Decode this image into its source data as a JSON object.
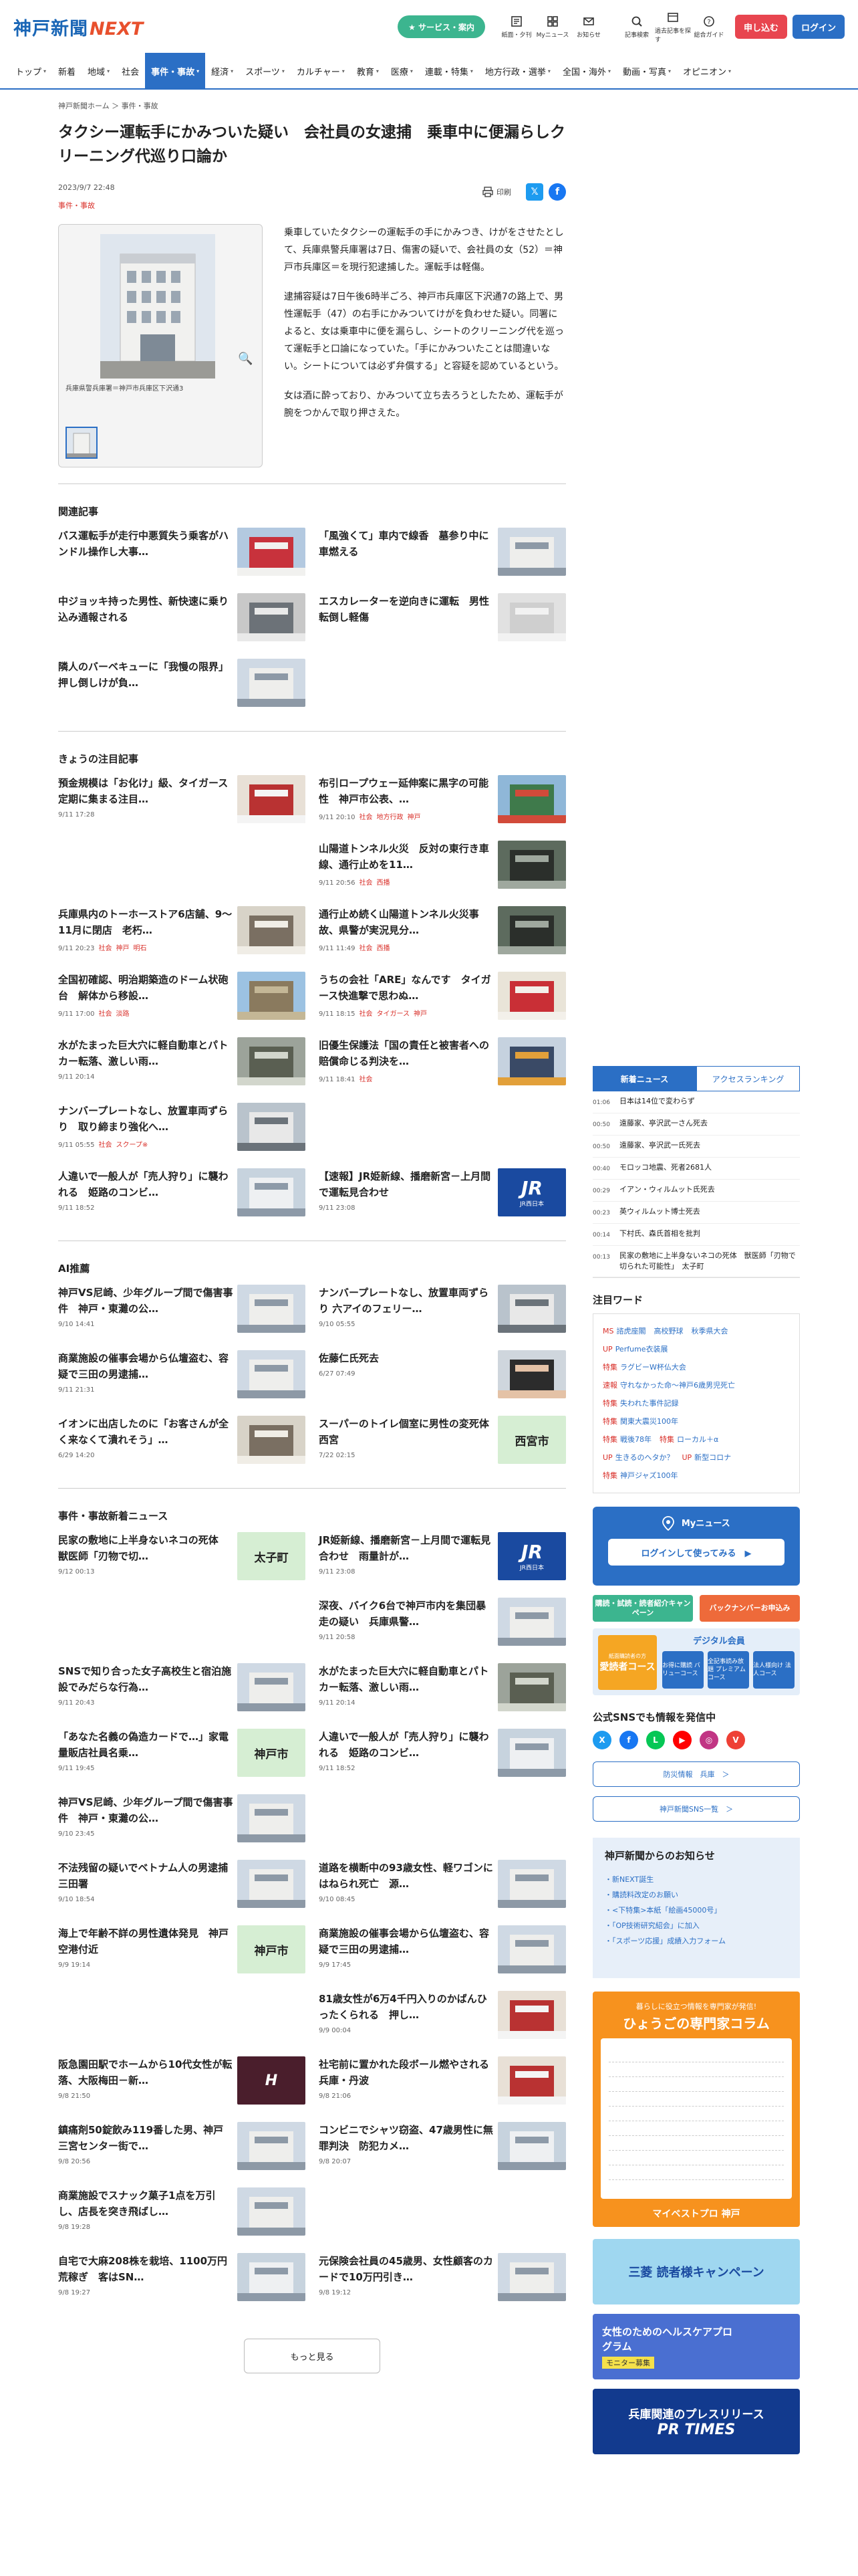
{
  "header": {
    "logo_main": "神戸新聞",
    "logo_sub": "NEXT",
    "service_btn": "★ サービス・案内",
    "icons": [
      {
        "label": "紙面・夕刊"
      },
      {
        "label": "Myニュース"
      },
      {
        "label": "お知らせ"
      }
    ],
    "icons2": [
      {
        "label": "記事検索"
      },
      {
        "label": "過去記事を探す"
      },
      {
        "label": "総合ガイド"
      }
    ],
    "signup": "申し込む",
    "login": "ログイン"
  },
  "nav": [
    {
      "label": "トップ",
      "chev": "▾"
    },
    {
      "label": "新着",
      "chev": ""
    },
    {
      "label": "地域",
      "chev": "▾"
    },
    {
      "label": "社会",
      "chev": ""
    },
    {
      "label": "事件・事故",
      "chev": "▾",
      "active": true
    },
    {
      "label": "経済",
      "chev": "▾"
    },
    {
      "label": "スポーツ",
      "chev": "▾"
    },
    {
      "label": "カルチャー",
      "chev": "▾"
    },
    {
      "label": "教育",
      "chev": "▾"
    },
    {
      "label": "医療",
      "chev": "▾"
    },
    {
      "label": "連載・特集",
      "chev": "▾"
    },
    {
      "label": "地方行政・選挙",
      "chev": "▾"
    },
    {
      "label": "全国・海外",
      "chev": "▾"
    },
    {
      "label": "動画・写真",
      "chev": "▾"
    },
    {
      "label": "オピニオン",
      "chev": "▾"
    }
  ],
  "breadcrumb": "神戸新聞ホーム ＞ 事件・事故",
  "article": {
    "title": "タクシー運転手にかみついた疑い　会社員の女逮捕　乗車中に便漏らしクリーニング代巡り口論か",
    "date": "2023/9/7 22:48",
    "category": "事件・事故",
    "print_label": "印刷",
    "photo_caption": "兵庫県警兵庫署＝神戸市兵庫区下沢通3",
    "paragraphs": [
      "乗車していたタクシーの運転手の手にかみつき、けがをさせたとして、兵庫県警兵庫署は7日、傷害の疑いで、会社員の女（52）＝神戸市兵庫区＝を現行犯逮捕した。運転手は軽傷。",
      "逮捕容疑は7日午後6時半ごろ、神戸市兵庫区下沢通7の路上で、男性運転手（47）の右手にかみついてけがを負わせた疑い。同署によると、女は乗車中に便を漏らし、シートのクリーニング代を巡って運転手と口論になっていた。「手にかみついたことは間違いない。シートについては必ず弁償する」と容疑を認めているという。",
      "女は酒に酔っており、かみついて立ち去ろうとしたため、運転手が腕をつかんで取り押さえた。"
    ]
  },
  "related": {
    "title": "関連記事",
    "items": [
      {
        "title": "バス運転手が走行中悪質失う乗客がハンドル操作し大事…",
        "thumb": "bus"
      },
      {
        "title": "「風強くて」車内で線香　墓参り中に車燃える",
        "thumb": "building"
      },
      {
        "title": "中ジョッキ持った男性、新快速に乗り込み通報される",
        "thumb": "station"
      },
      {
        "title": "エスカレーターを逆向きに運転　男性転倒し軽傷",
        "thumb": "gray"
      },
      {
        "title": "隣人のバーベキューに「我慢の限界」　押し倒しけが負…",
        "thumb": "building"
      }
    ]
  },
  "featured": {
    "title": "きょうの注目記事",
    "items": [
      {
        "title": "預金規模は「お化け」級、タイガース定期に集まる注目…",
        "date": "9/11 17:28",
        "tags": [],
        "thumb": "red"
      },
      {
        "title": "布引ロープウェー延伸案に黒字の可能性　神戸市公表、…",
        "date": "9/11 20:10",
        "tags": [
          "社会",
          "地方行政",
          "神戸"
        ],
        "thumb": "mountain"
      },
      {
        "title": "",
        "date": "",
        "tags": [],
        "thumb": "none"
      },
      {
        "title": "山陽道トンネル火災　反対の東行き車線、通行止めを11…",
        "date": "9/11 20:56",
        "tags": [
          "社会",
          "西播"
        ],
        "thumb": "tunnel"
      },
      {
        "title": "兵庫県内のトーホーストア6店舗、9～11月に閉店　老朽…",
        "date": "9/11 20:23",
        "tags": [
          "社会",
          "神戸",
          "明石"
        ],
        "thumb": "store"
      },
      {
        "title": "通行止め続く山陽道トンネル火災事故、県警が実況見分…",
        "date": "9/11 11:49",
        "tags": [
          "社会",
          "西播"
        ],
        "thumb": "tunnel"
      },
      {
        "title": "全国初確認、明治期築造のドーム状砲台　解体から移設…",
        "date": "9/11 17:00",
        "tags": [
          "社会",
          "淡路"
        ],
        "thumb": "dome"
      },
      {
        "title": "うちの会社「ARE」なんです　タイガース快進撃で思わぬ…",
        "date": "9/11 18:15",
        "tags": [
          "社会",
          "タイガース",
          "神戸"
        ],
        "thumb": "are"
      },
      {
        "title": "水がたまった巨大穴に軽自動車とパトカー転落、激しい雨…",
        "date": "9/11 20:14",
        "tags": [],
        "thumb": "flood"
      },
      {
        "title": "旧優生保護法「国の責任と被害者への賠償命じる判決を…",
        "date": "9/11 18:41",
        "tags": [
          "社会"
        ],
        "thumb": "crowd"
      },
      {
        "title": "ナンバープレートなし、放置車両ずらり　取り締まり強化へ…",
        "date": "9/11 05:55",
        "tags": [
          "社会",
          "スクープ※"
        ],
        "thumb": "car"
      },
      {
        "title": "",
        "date": "",
        "tags": [],
        "thumb": "none"
      },
      {
        "title": "人違いで一般人が「売人狩り」に襲われる　姫路のコンビ…",
        "date": "9/11 18:52",
        "tags": [],
        "thumb": "court"
      },
      {
        "title": "【速報】JR姫新線、播磨新宮－上月間で運転見合わせ",
        "date": "9/11 23:08",
        "tags": [],
        "thumb": "jr"
      }
    ]
  },
  "ai": {
    "title": "AI推薦",
    "items": [
      {
        "title": "神戸VS尼崎、少年グループ間で傷害事件　神戸・東灘の公…",
        "date": "9/10 14:41",
        "thumb": "building"
      },
      {
        "title": "ナンバープレートなし、放置車両ずらり 六アイのフェリー…",
        "date": "9/10 05:55",
        "thumb": "car"
      },
      {
        "title": "商業施設の催事会場から仏壇盗む、容疑で三田の男逮捕…",
        "date": "9/11 21:31",
        "thumb": "building"
      },
      {
        "title": "佐藤仁氏死去",
        "date": "6/27 07:49",
        "thumb": "person"
      },
      {
        "title": "イオンに出店したのに「お客さんが全く来なくて潰れそう」…",
        "date": "6/29 14:20",
        "thumb": "store"
      },
      {
        "title": "スーパーのトイレ個室に男性の変死体 西宮",
        "date": "7/22 02:15",
        "thumb": "green",
        "green": "西宮市"
      }
    ]
  },
  "latest": {
    "title": "事件・事故新着ニュース",
    "items": [
      {
        "title": "民家の敷地に上半身ないネコの死体　獣医師「刃物で切…",
        "date": "9/12 00:13",
        "thumb": "green",
        "green": "太子町"
      },
      {
        "title": "JR姫新線、播磨新宮－上月間で運転見合わせ　雨量計が…",
        "date": "9/11 23:08",
        "thumb": "jr"
      },
      {
        "title": "",
        "date": "",
        "thumb": "none"
      },
      {
        "title": "深夜、バイク6台で神戸市内を集団暴走の疑い　兵庫県警…",
        "date": "9/11 20:58",
        "thumb": "building"
      },
      {
        "title": "SNSで知り合った女子高校生と宿泊施設でみだらな行為…",
        "date": "9/11 20:43",
        "thumb": "building"
      },
      {
        "title": "水がたまった巨大穴に軽自動車とパトカー転落、激しい雨…",
        "date": "9/11 20:14",
        "thumb": "flood"
      },
      {
        "title": "「あなた名義の偽造カードで…」家電量販店社員名乗…",
        "date": "9/11 19:45",
        "thumb": "green",
        "green": "神戸市"
      },
      {
        "title": "人違いで一般人が「売人狩り」に襲われる　姫路のコンビ…",
        "date": "9/11 18:52",
        "thumb": "court"
      },
      {
        "title": "神戸VS尼崎、少年グループ間で傷害事件　神戸・東灘の公…",
        "date": "9/10 23:45",
        "thumb": "building"
      },
      {
        "title": "",
        "date": "",
        "thumb": "none"
      },
      {
        "title": "不法残留の疑いでベトナム人の男逮捕　三田署",
        "date": "9/10 18:54",
        "thumb": "building"
      },
      {
        "title": "道路を横断中の93歳女性、軽ワゴンにはねられ死亡　源…",
        "date": "9/10 08:45",
        "thumb": "building"
      },
      {
        "title": "海上で年齢不詳の男性遺体発見　神戸空港付近",
        "date": "9/9 19:14",
        "thumb": "green",
        "green": "神戸市"
      },
      {
        "title": "商業施設の催事会場から仏壇盗む、容疑で三田の男逮捕…",
        "date": "9/9 17:45",
        "thumb": "building"
      },
      {
        "title": "",
        "date": "",
        "thumb": "none"
      },
      {
        "title": "81歳女性が6万4千円入りのかばんひったくられる　押し…",
        "date": "9/9 00:04",
        "thumb": "red"
      },
      {
        "title": "阪急園田駅でホームから10代女性が転落、大阪梅田－新…",
        "date": "9/8 21:50",
        "thumb": "hk"
      },
      {
        "title": "社宅前に置かれた段ボール燃やされる　兵庫・丹波",
        "date": "9/8 21:06",
        "thumb": "red"
      },
      {
        "title": "鎮痛剤50錠飲み119番した男、神戸三宮センター街で…",
        "date": "9/8 20:56",
        "thumb": "building"
      },
      {
        "title": "コンビニでシャツ窃盗、47歳男性に無罪判決　防犯カメ…",
        "date": "9/8 20:07",
        "thumb": "court"
      },
      {
        "title": "商業施設でスナック菓子1点を万引し、店長を突き飛ばし…",
        "date": "9/8 19:28",
        "thumb": "building"
      },
      {
        "title": "",
        "date": "",
        "thumb": "none"
      },
      {
        "title": "自宅で大麻208株を栽培、1100万円荒稼ぎ　客はSN…",
        "date": "9/8 19:27",
        "thumb": "court"
      },
      {
        "title": "元保険会社員の45歳男、女性顧客のカードで10万円引き…",
        "date": "9/8 19:12",
        "thumb": "building"
      }
    ],
    "more": "もっと見る"
  },
  "sidebar": {
    "tabs": [
      "新着ニュース",
      "アクセスランキング"
    ],
    "news": [
      {
        "time": "01:06",
        "title": "日本は14位で変わらず"
      },
      {
        "time": "00:50",
        "title": "遠藤家、亭沢武一さん死去"
      },
      {
        "time": "00:50",
        "title": "遠藤家、亭沢武一氏死去"
      },
      {
        "time": "00:40",
        "title": "モロッコ地震、死者2681人"
      },
      {
        "time": "00:29",
        "title": "イアン・ウィルムット氏死去"
      },
      {
        "time": "00:23",
        "title": "英ウィルムット博士死去"
      },
      {
        "time": "00:14",
        "title": "下村氏、森氏首相を批判"
      },
      {
        "time": "00:13",
        "title": "民家の敷地に上半身ないネコの死体　獣医師「刃物で切られた可能性」　太子町"
      }
    ],
    "words_title": "注目ワード",
    "words": [
      [
        {
          "pre": "MS",
          "txt": "諮虎座閣"
        },
        {
          "pre": "",
          "txt": "高校野球"
        },
        {
          "pre": "",
          "txt": "秋季県大会"
        }
      ],
      [
        {
          "pre": "UP",
          "txt": "Perfume衣装展"
        }
      ],
      [
        {
          "pre": "特集",
          "txt": "ラグビーW杯仏大会"
        }
      ],
      [
        {
          "pre": "速報",
          "txt": "守れなかった命～神戸6歳男児死亡"
        }
      ],
      [
        {
          "pre": "特集",
          "txt": "失われた事件記録"
        }
      ],
      [
        {
          "pre": "特集",
          "txt": "関東大震災100年"
        }
      ],
      [
        {
          "pre": "特集",
          "txt": "戦後78年"
        },
        {
          "pre": "特集",
          "txt": "ローカル＋α"
        }
      ],
      [
        {
          "pre": "UP",
          "txt": "生きるのへタか？"
        },
        {
          "pre": "UP",
          "txt": "新型コロナ"
        }
      ],
      [
        {
          "pre": "特集",
          "txt": "神戸ジャズ100年"
        }
      ]
    ],
    "mynews_title": "Myニュース",
    "mynews_btn": "ログインして使ってみる　▶",
    "promo1": "購読・試読・読者紹介キャンペーン",
    "promo2": "バックナンバーお申込み",
    "digital_left": "愛読者コース",
    "digital_left_sub": "紙面購読者の方",
    "digital_head": "デジタル会員",
    "digital_boxes": [
      "お得に購読 バリューコース",
      "全記事読み放題 プレミアムコース",
      "法人様向け 法人コース"
    ],
    "sns_title": "公式SNSでも情報を発信中",
    "sns": [
      "X",
      "f",
      "L",
      "▶",
      "◎",
      "V"
    ],
    "link1": "防災情報　兵庫　＞",
    "link2": "神戸新聞SNS一覧　＞",
    "notice_title": "神戸新聞からのお知らせ",
    "notices": [
      "・新NEXT誕生",
      "・購読料改定のお願い",
      "・<下特集>本紙「絵画45000号」",
      "・「OP技術研究紹会」に加入",
      "・「スポーツ応援」成績入力フォーム"
    ],
    "column_sub": "暮らしに役立つ情報を専門家が発信!",
    "column_title": "ひょうごの専門家コラム",
    "column_foot": "マイベストプロ 神戸",
    "banner1": "三菱 読者様キャンペーン",
    "banner2": "女性のためのヘルスケアプログラム",
    "banner2_sub": "モニター募集",
    "banner3": "兵庫関連のプレスリリース",
    "banner3_sub": "PR TIMES"
  }
}
